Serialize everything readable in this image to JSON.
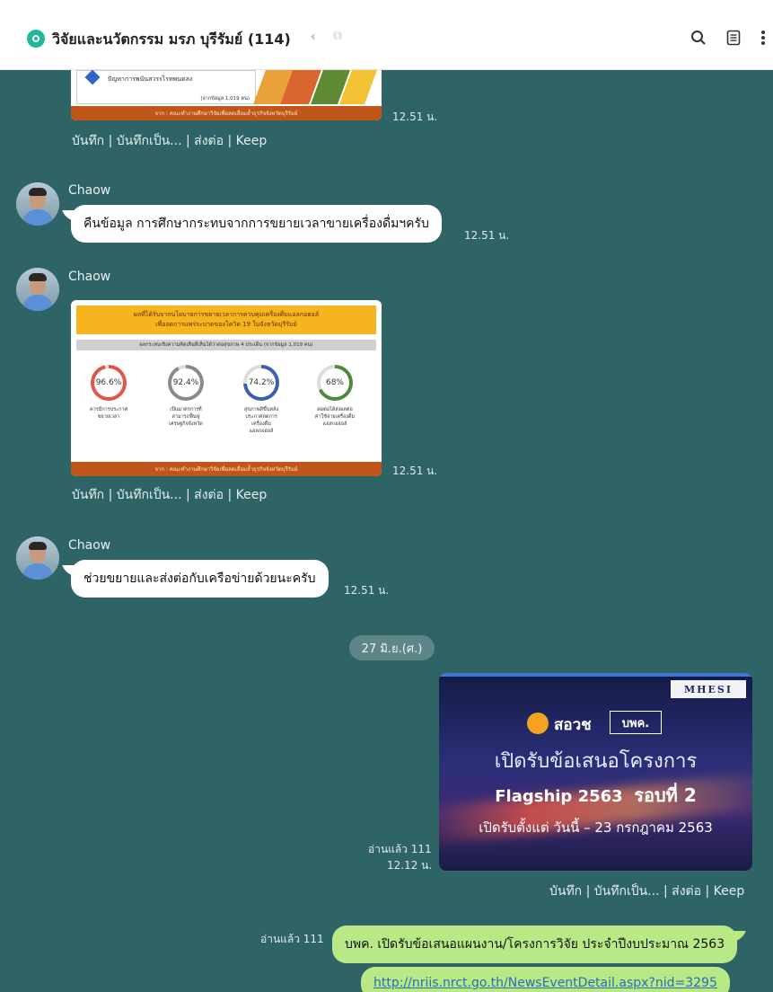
{
  "header": {
    "title": "วิจัยและนวัตกรรม มรภ บุรีรัมย์ (114)",
    "mute_icon": "speaker-muted-icon",
    "copy_icon": "copy-icon",
    "search_icon": "search-icon",
    "notes_icon": "notes-icon",
    "menu_icon": "more-vertical-icon"
  },
  "messages": [
    {
      "type": "image",
      "image": {
        "line1": "ปัญหาการพนันสวรรไรทพนดลง",
        "line2": "(จากข้อมูล 1,019 คน)",
        "footer": "จาก : คณะทำงานศึกษาวิจัยเพื่อลดเลื่อมล้ำธุรกิจจังหวัดบุรีรัมย์"
      },
      "time": "12.51 น.",
      "actions": "บันทึก | บันทึกเป็น... | ส่งต่อ | Keep"
    },
    {
      "type": "text",
      "sender": "Chaow",
      "text": "คืนข้อมูล การศึกษากระทบจากการขยายเวลาขายเครื่องดื่มฯครับ",
      "time": "12.51 น."
    },
    {
      "type": "image",
      "sender": "Chaow",
      "image": {
        "banner1": "ผลที่ได้รับจากนโยบายการขยายเวลาการควบคุมเครื่องดื่มแอลกอฮอล์",
        "banner2": "เพื่อลดการแพร่ระบาดของโควิด 19 ในจังหวัดบุรีรัมย์",
        "sub": "ผลกระทบเชิงความคิดเห็นที่เห็นได้ว่าต่อสุขภาพ 4 ประเด็น (จากข้อมูล 1,019 คน)",
        "stats": [
          {
            "value": "96.6%",
            "label": "ควรมีการประกาศ ขยายเวลา",
            "color": "#e0574a",
            "percent": 96.6
          },
          {
            "value": "92.4%",
            "label": "เป็นมาตรการที่ สามารถฟื้นฟู เศรษฐกิจจังหวัด",
            "color": "#8a8a8a",
            "percent": 92.4
          },
          {
            "value": "74.2%",
            "label": "สุขภาพดีขึ้นหลัง ประกาศลดการ เครื่องดื่มแอลกอฮอล์",
            "color": "#3c5fb0",
            "percent": 74.2
          },
          {
            "value": "68%",
            "label": "ต่อต่อได้ส่งผลต่อ ค่าใช้จ่ายเครื่องดื่ม แอลกอฮอล์",
            "color": "#4f8a3b",
            "percent": 68
          }
        ],
        "footer": "จาก : คณะทำงานศึกษาวิจัยเพื่อลดเลื่อมล้ำธุรกิจจังหวัดบุรีรัมย์"
      },
      "time": "12.51 น.",
      "actions": "บันทึก | บันทึกเป็น... | ส่งต่อ | Keep"
    },
    {
      "type": "text",
      "sender": "Chaow",
      "text": "ช่วยขยายและส่งต่อกับเครือข่ายด้วยนะครับ",
      "time": "12.51 น."
    }
  ],
  "date_separator": "27 มิ.ย.(ศ.)",
  "promo": {
    "brand_logo": "สอวช",
    "brand_logo2": "บพค.",
    "corner_logo": "MHESI",
    "line1": "เปิดรับข้อเสนอโครงการ",
    "line2_a": "Flagship 2563",
    "line2_b": "รอบที่ 2",
    "line3": "เปิดรับตั้งแต่ วันนี้ – 23 กรกฎาคม 2563",
    "read": "อ่านแล้ว 111",
    "time": "12.12 น.",
    "actions": "บันทึก | บันทึกเป็น... | ส่งต่อ | Keep"
  },
  "my_message": {
    "read": "อ่านแล้ว 111",
    "text": "บพค. เปิดรับข้อเสนอแผนงาน/โครงการวิจัย ประจำปีงบประมาณ 2563",
    "link": "http://nriis.nrct.go.th/NewsEventDetail.aspx?nid=3295"
  },
  "colors": {
    "chat_bg": "#2f6466",
    "my_bubble": "#b8e986",
    "other_bubble": "#ffffff"
  }
}
